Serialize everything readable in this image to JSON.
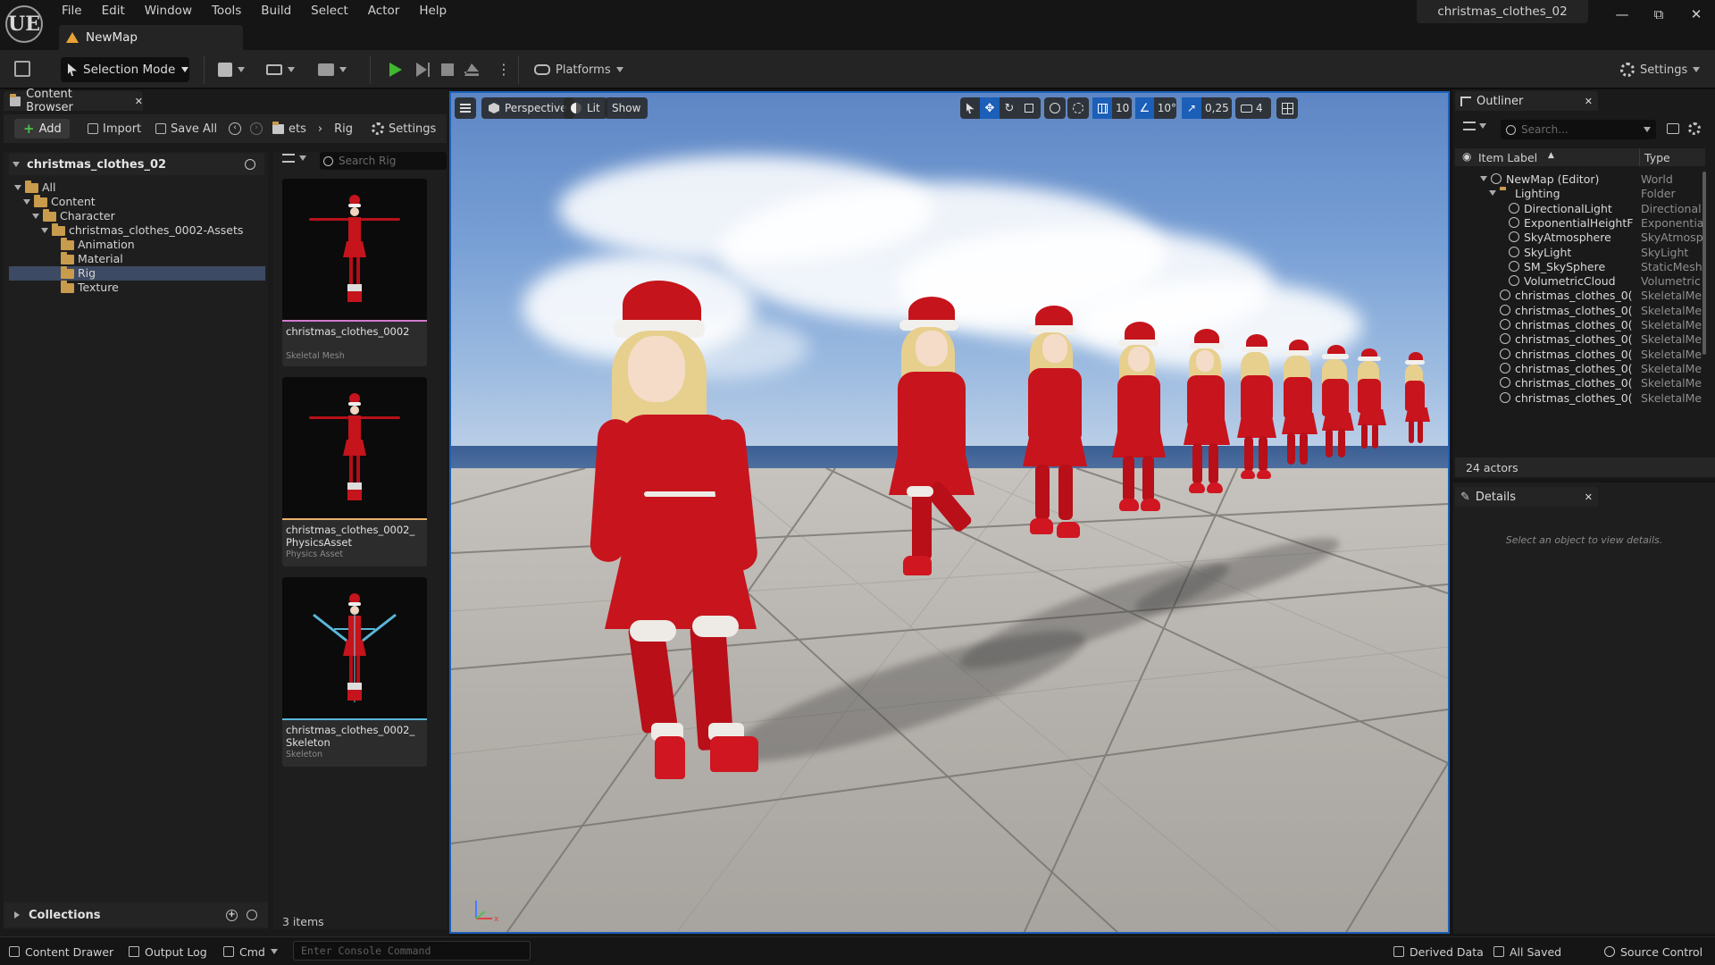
{
  "app": {
    "logo": "UE",
    "project_name": "christmas_clothes_02",
    "menu": [
      "File",
      "Edit",
      "Window",
      "Tools",
      "Build",
      "Select",
      "Actor",
      "Help"
    ],
    "window_buttons": [
      "minimize-icon",
      "restore-icon",
      "close-icon"
    ],
    "level_tab": "NewMap"
  },
  "toolbar": {
    "selection_mode": "Selection Mode",
    "platforms": "Platforms",
    "settings": "Settings",
    "play_color": "#40b830"
  },
  "content_browser": {
    "tab_title": "Content Browser",
    "add": "Add",
    "import": "Import",
    "save_all": "Save All",
    "breadcrumb": [
      "ets",
      "Rig"
    ],
    "settings": "Settings",
    "tree_title": "christmas_clothes_02",
    "tree": [
      {
        "label": "All",
        "level": 0,
        "expanded": true
      },
      {
        "label": "Content",
        "level": 1,
        "expanded": true
      },
      {
        "label": "Character",
        "level": 2,
        "expanded": true
      },
      {
        "label": "christmas_clothes_0002-Assets",
        "level": 3,
        "expanded": true
      },
      {
        "label": "Animation",
        "level": 4
      },
      {
        "label": "Material",
        "level": 4
      },
      {
        "label": "Rig",
        "level": 4,
        "selected": true
      },
      {
        "label": "Texture",
        "level": 4
      }
    ],
    "search_placeholder": "Search Rig",
    "assets": [
      {
        "name": "christmas_clothes_0002",
        "type": "Skeletal Mesh",
        "stripe": "#d07ad0"
      },
      {
        "name": "christmas_clothes_0002_\nPhysicsAsset",
        "type": "Physics Asset",
        "stripe": "#e8b06a"
      },
      {
        "name": "christmas_clothes_0002_\nSkeleton",
        "type": "Skeleton",
        "stripe": "#5ab6d8"
      }
    ],
    "item_count": "3 items",
    "collections": "Collections"
  },
  "viewport": {
    "perspective": "Perspective",
    "lit": "Lit",
    "show": "Show",
    "grid_snap": "10",
    "rotation_snap": "10°",
    "scale_snap": "0,25",
    "camera_speed": "4",
    "accent": "#1c5fb8"
  },
  "outliner": {
    "tab_title": "Outliner",
    "search_placeholder": "Search...",
    "col_label": "Item Label",
    "col_type": "Type",
    "rows": [
      {
        "label": "NewMap (Editor)",
        "type": "World",
        "indent": 1,
        "icon": "map-icon"
      },
      {
        "label": "Lighting",
        "type": "Folder",
        "indent": 2,
        "icon": "folder-icon"
      },
      {
        "label": "DirectionalLight",
        "type": "Directional",
        "indent": 3,
        "icon": "sun-icon"
      },
      {
        "label": "ExponentialHeightF",
        "type": "Exponentia",
        "indent": 3,
        "icon": "fog-icon"
      },
      {
        "label": "SkyAtmosphere",
        "type": "SkyAtmosp",
        "indent": 3,
        "icon": "atmosphere-icon"
      },
      {
        "label": "SkyLight",
        "type": "SkyLight",
        "indent": 3,
        "icon": "skylight-icon"
      },
      {
        "label": "SM_SkySphere",
        "type": "StaticMesh",
        "indent": 3,
        "icon": "mesh-icon"
      },
      {
        "label": "VolumetricCloud",
        "type": "Volumetric",
        "indent": 3,
        "icon": "cloud-icon"
      },
      {
        "label": "christmas_clothes_0(",
        "type": "SkeletalMe",
        "indent": 2,
        "icon": "skeletal-mesh-icon"
      },
      {
        "label": "christmas_clothes_0(",
        "type": "SkeletalMe",
        "indent": 2,
        "icon": "skeletal-mesh-icon"
      },
      {
        "label": "christmas_clothes_0(",
        "type": "SkeletalMe",
        "indent": 2,
        "icon": "skeletal-mesh-icon"
      },
      {
        "label": "christmas_clothes_0(",
        "type": "SkeletalMe",
        "indent": 2,
        "icon": "skeletal-mesh-icon"
      },
      {
        "label": "christmas_clothes_0(",
        "type": "SkeletalMe",
        "indent": 2,
        "icon": "skeletal-mesh-icon"
      },
      {
        "label": "christmas_clothes_0(",
        "type": "SkeletalMe",
        "indent": 2,
        "icon": "skeletal-mesh-icon"
      },
      {
        "label": "christmas_clothes_0(",
        "type": "SkeletalMe",
        "indent": 2,
        "icon": "skeletal-mesh-icon"
      },
      {
        "label": "christmas_clothes_0(",
        "type": "SkeletalMe",
        "indent": 2,
        "icon": "skeletal-mesh-icon"
      }
    ],
    "actor_count": "24 actors"
  },
  "details": {
    "tab_title": "Details",
    "empty_message": "Select an object to view details."
  },
  "statusbar": {
    "content_drawer": "Content Drawer",
    "output_log": "Output Log",
    "cmd": "Cmd",
    "console_placeholder": "Enter Console Command",
    "derived_data": "Derived Data",
    "all_saved": "All Saved",
    "source_control": "Source Control"
  }
}
